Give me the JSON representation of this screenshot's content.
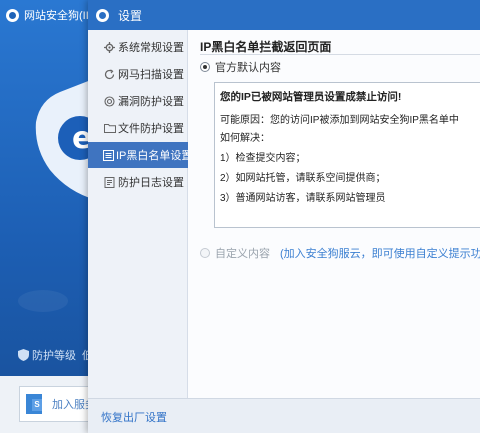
{
  "background_window": {
    "title": "网站安全狗(IIS",
    "protection_level_label": "防护等级",
    "protection_level_value": "低",
    "add_server_label": "加入服务"
  },
  "dialog": {
    "title": "设置"
  },
  "nav": {
    "items": [
      {
        "label": "系统常规设置",
        "icon": "gear-icon"
      },
      {
        "label": "网马扫描设置",
        "icon": "refresh-icon"
      },
      {
        "label": "漏洞防护设置",
        "icon": "target-icon"
      },
      {
        "label": "文件防护设置",
        "icon": "folder-icon"
      },
      {
        "label": "IP黑白名单设置",
        "icon": "ip-list-icon",
        "active": true
      },
      {
        "label": "防护日志设置",
        "icon": "log-icon"
      }
    ]
  },
  "content": {
    "section_title": "IP黑白名单拦截返回页面",
    "default_option_label": "官方默认内容",
    "default_selected": true,
    "message_lines": [
      "您的IP已被网站管理员设置成禁止访问!",
      "可能原因：您的访问IP被添加到网站安全狗IP黑名单中",
      "如何解决：",
      "1）检查提交内容；",
      "2）如网站托管，请联系空间提供商；",
      "3）普通网站访客，请联系网站管理员"
    ],
    "custom_option_label": "自定义内容",
    "custom_option_hint": "(加入安全狗服云，即可使用自定义提示功能)"
  },
  "footer": {
    "reset_label": "恢复出厂设置"
  },
  "colors": {
    "accent": "#2a6fc4",
    "nav_active": "#3f74c0",
    "link": "#3273c8"
  }
}
